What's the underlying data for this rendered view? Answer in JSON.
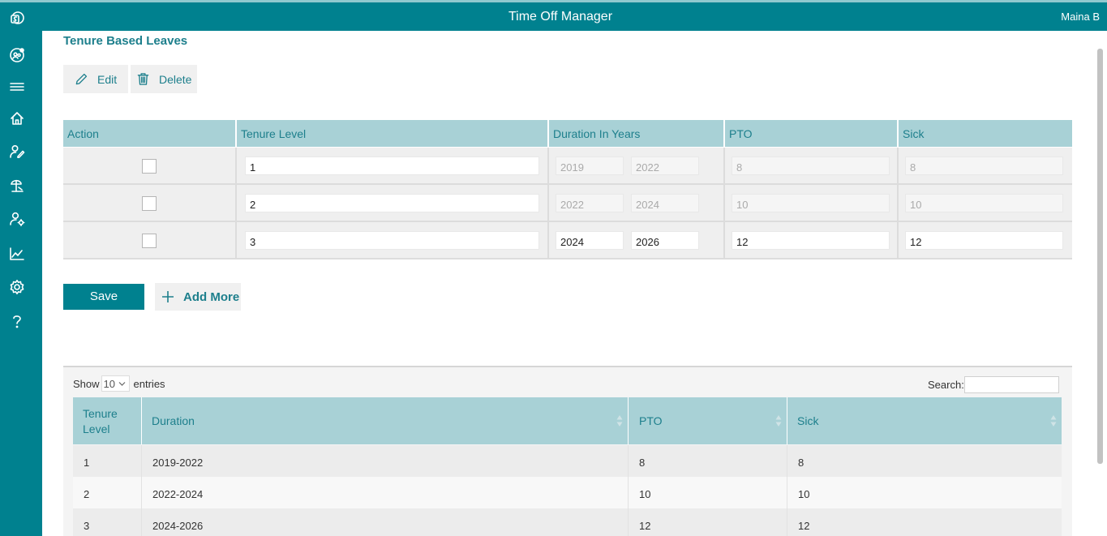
{
  "header": {
    "title": "Time Off Manager",
    "user": "Maina B"
  },
  "sidebar": {
    "icons": [
      "sharepoint-icon",
      "team-icon",
      "menu-icon",
      "home-icon",
      "user-edit-icon",
      "leave-icon",
      "user-settings-icon",
      "chart-icon",
      "settings-icon",
      "help-icon"
    ]
  },
  "page": {
    "title": "Tenure Based Leaves"
  },
  "toolbar": {
    "edit_label": "Edit",
    "delete_label": "Delete"
  },
  "grid": {
    "headers": [
      "Action",
      "Tenure Level",
      "Duration In Years",
      "PTO",
      "Sick"
    ],
    "rows": [
      {
        "level": "1",
        "from": "2019",
        "to": "2022",
        "pto": "8",
        "sick": "8"
      },
      {
        "level": "2",
        "from": "2022",
        "to": "2024",
        "pto": "10",
        "sick": "10"
      },
      {
        "level": "3",
        "from": "2024",
        "to": "2026",
        "pto": "12",
        "sick": "12"
      }
    ]
  },
  "actions": {
    "save_label": "Save",
    "add_more_label": "Add More"
  },
  "datatable": {
    "show_label": "Show",
    "page_length": "10",
    "entries_label": "entries",
    "search_label": "Search:",
    "headers": [
      "Tenure Level",
      "Duration",
      "PTO",
      "Sick"
    ],
    "rows": [
      {
        "level": "1",
        "duration": "2019-2022",
        "pto": "8",
        "sick": "8"
      },
      {
        "level": "2",
        "duration": "2022-2024",
        "pto": "10",
        "sick": "10"
      },
      {
        "level": "3",
        "duration": "2024-2026",
        "pto": "12",
        "sick": "12"
      }
    ]
  },
  "colors": {
    "primary": "#00818f",
    "header_cell": "#a8d1d6",
    "accent_text": "#1d7f8c"
  }
}
